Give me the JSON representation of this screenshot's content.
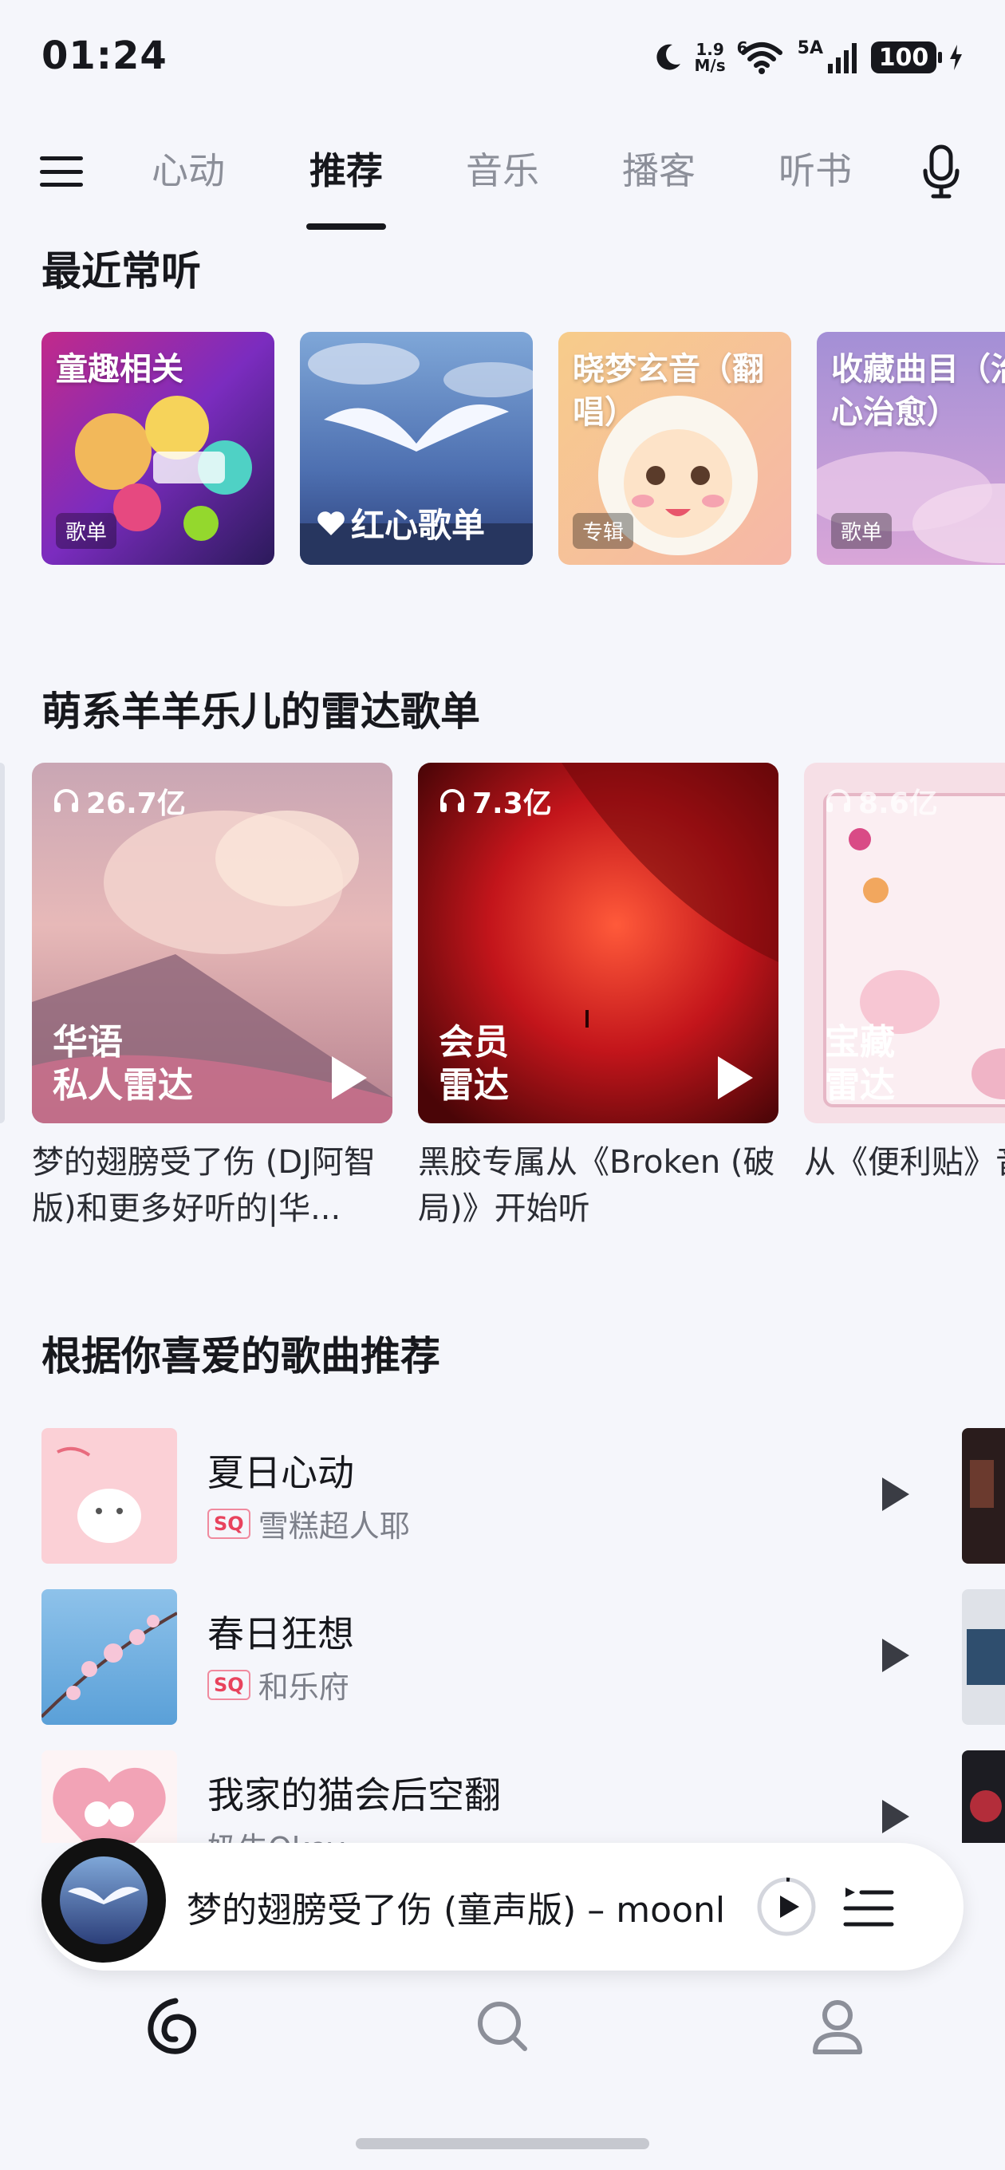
{
  "status_bar": {
    "time": "01:24",
    "net_speed_value": "1.9",
    "net_speed_unit": "M/s",
    "wifi_badge": "6",
    "signal_badge": "5A",
    "battery": "100"
  },
  "top_nav": {
    "tabs": [
      {
        "label": "心动",
        "active": false
      },
      {
        "label": "推荐",
        "active": true
      },
      {
        "label": "音乐",
        "active": false
      },
      {
        "label": "播客",
        "active": false
      },
      {
        "label": "听书",
        "active": false
      }
    ]
  },
  "recent": {
    "title": "最近常听",
    "cards": [
      {
        "title": "童趣相关",
        "badge": "歌单"
      },
      {
        "title": "红心歌单",
        "badge": ""
      },
      {
        "title": "晓梦玄音（翻唱）",
        "badge": "专辑"
      },
      {
        "title": "收藏曲目（治心治愈）",
        "badge": "歌单"
      }
    ]
  },
  "radar": {
    "title": "萌系羊羊乐儿的雷达歌单",
    "cards": [
      {
        "plays": "26.7亿",
        "label_line1": "华语",
        "label_line2": "私人雷达",
        "desc": "梦的翅膀受了伤 (DJ阿智版)和更多好听的|华..."
      },
      {
        "plays": "7.3亿",
        "label_line1": "会员",
        "label_line2": "雷达",
        "desc": "黑胶专属从《Broken (破局)》开始听"
      },
      {
        "plays": "8.6亿",
        "label_line1": "宝藏",
        "label_line2": "雷达",
        "desc": "从《便利贴》音乐环游"
      }
    ]
  },
  "recommend": {
    "title": "根据你喜爱的歌曲推荐",
    "songs": [
      {
        "title": "夏日心动",
        "sq": "SQ",
        "artist": "雪糕超人耶"
      },
      {
        "title": "春日狂想",
        "sq": "SQ",
        "artist": "和乐府"
      },
      {
        "title": "我家的猫会后空翻",
        "sq": "",
        "artist": "奶牛Okey"
      }
    ]
  },
  "mini_player": {
    "title": "梦的翅膀受了伤 (童声版) – moonl"
  },
  "icons": {
    "menu": "menu-icon",
    "mic": "microphone-icon",
    "home": "netease-music-logo-icon",
    "search": "search-icon",
    "profile": "profile-icon"
  },
  "colors": {
    "background": "#f5f6fb",
    "text_primary": "#17181d",
    "text_secondary": "#8c8f99",
    "sq_badge": "#e8435d"
  }
}
